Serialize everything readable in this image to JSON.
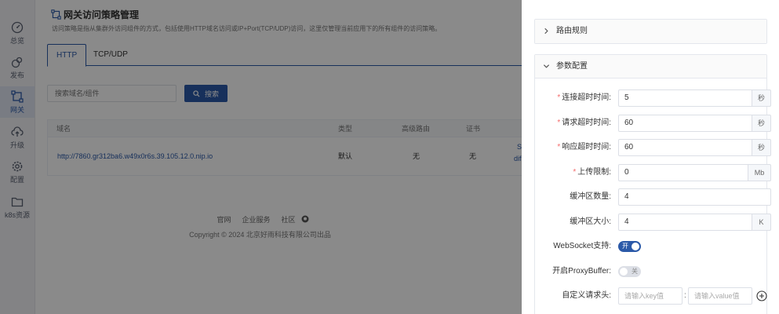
{
  "nav": {
    "items": [
      {
        "label": "总览",
        "icon": "dashboard-icon"
      },
      {
        "label": "发布",
        "icon": "rocket-icon"
      },
      {
        "label": "网关",
        "icon": "gateway-icon"
      },
      {
        "label": "升级",
        "icon": "cloud-upload-icon"
      },
      {
        "label": "配置",
        "icon": "gear-icon"
      },
      {
        "label": "k8s资源",
        "icon": "folder-icon"
      }
    ],
    "active": "网关"
  },
  "page": {
    "title": "网关访问策略管理",
    "description": "访问策略是指从集群外访问组件的方式，包括使用HTTP域名访问或IP+Port(TCP/UDP)访问，这里仅管理当前应用下的所有组件的访问策略。"
  },
  "tabs": [
    {
      "label": "HTTP",
      "active": true
    },
    {
      "label": "TCP/UDP",
      "active": false
    }
  ],
  "search": {
    "placeholder": "搜索域名/组件",
    "button_label": "搜索"
  },
  "table": {
    "columns": [
      "域名",
      "类型",
      "高级路由",
      "证书"
    ],
    "rows": [
      {
        "domain": "http://7860.gr312ba6.w49x0r6s.39.105.12.0.nip.io",
        "type": "默认",
        "advanced_route": "无",
        "cert": "无",
        "extra": "S",
        "extra2": "dif"
      }
    ]
  },
  "footer": {
    "links": [
      "官网",
      "企业服务",
      "社区"
    ],
    "copyright": "Copyright © 2024 北京好雨科技有限公司出品"
  },
  "drawer": {
    "route_panel_title": "路由规则",
    "params_panel_title": "参数配置",
    "fields": {
      "connect_timeout": {
        "label": "连接超时时间:",
        "value": "5",
        "unit": "秒",
        "required": true
      },
      "request_timeout": {
        "label": "请求超时时间:",
        "value": "60",
        "unit": "秒",
        "required": true
      },
      "response_timeout": {
        "label": "响应超时时间:",
        "value": "60",
        "unit": "秒",
        "required": true
      },
      "upload_limit": {
        "label": "上传限制:",
        "value": "0",
        "unit": "Mb",
        "required": true
      },
      "buffer_count": {
        "label": "缓冲区数量:",
        "value": "4"
      },
      "buffer_size": {
        "label": "缓冲区大小:",
        "value": "4",
        "unit": "K"
      },
      "websocket": {
        "label": "WebSocket支持:",
        "state_text": "开",
        "on": true
      },
      "proxy_buffer": {
        "label": "开启ProxyBuffer:",
        "state_text": "关",
        "on": false
      },
      "custom_header": {
        "label": "自定义请求头:",
        "key_placeholder": "请输入key值",
        "value_placeholder": "请输入value值",
        "separator": ":"
      }
    },
    "required_mark": "*"
  },
  "colors": {
    "primary": "#2b59a8",
    "required": "#f56c6c"
  }
}
